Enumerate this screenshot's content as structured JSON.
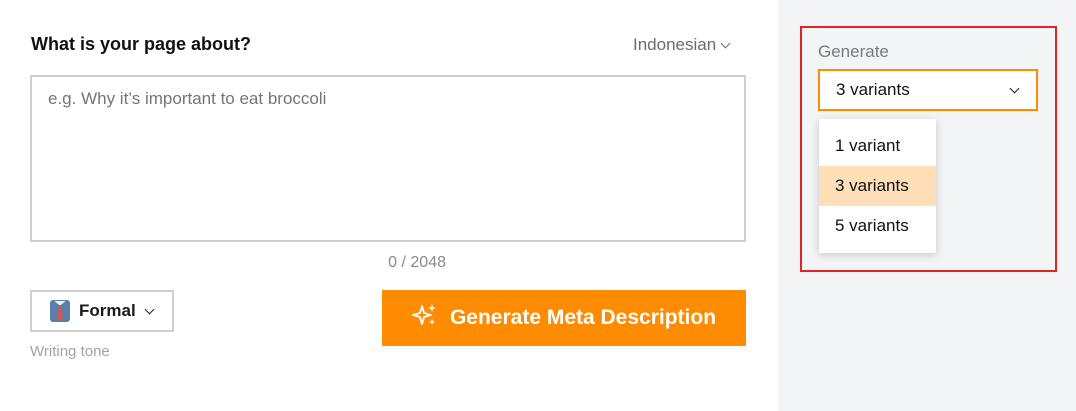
{
  "form": {
    "question": "What is your page about?",
    "language": "Indonesian",
    "textarea_placeholder": "e.g. Why it’s important to eat broccoli",
    "counter": "0 / 2048",
    "tone_label": "Formal",
    "tone_caption": "Writing tone",
    "generate_button": "Generate Meta Description"
  },
  "sidebar": {
    "label": "Generate",
    "selected_value": "3 variants",
    "options": [
      {
        "label": "1 variant"
      },
      {
        "label": "3 variants",
        "selected": true
      },
      {
        "label": "5 variants"
      }
    ]
  },
  "colors": {
    "accent": "#ff8c00",
    "highlight_border": "#e02424",
    "selected_option_bg": "#ffdfb8",
    "sidebar_bg": "#f3f4f6"
  },
  "icons": {
    "tone": "necktie-icon",
    "generate": "sparkles-icon",
    "dropdown": "chevron-down-icon"
  }
}
